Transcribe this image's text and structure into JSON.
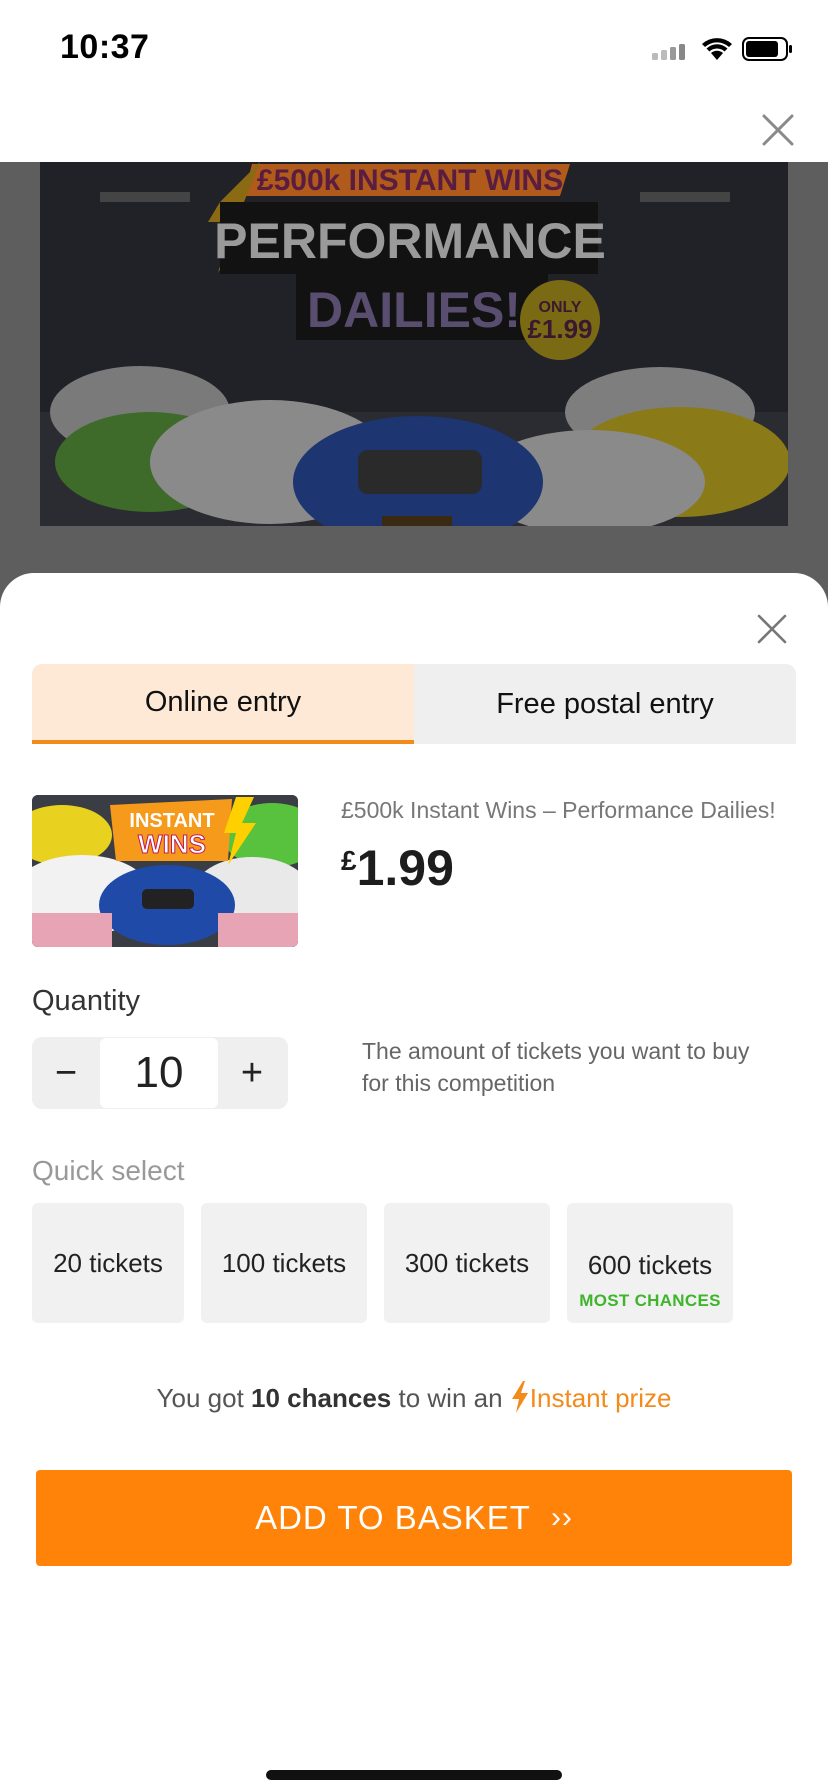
{
  "status_bar": {
    "time": "10:37"
  },
  "modal": {
    "tabs": [
      {
        "label": "Online entry",
        "active": true
      },
      {
        "label": "Free postal entry",
        "active": false
      }
    ],
    "product": {
      "title": "£500k Instant Wins – Performance Dailies!",
      "currency": "£",
      "price": "1.99",
      "thumb_text": {
        "line1": "INSTANT",
        "line2": "WINS"
      }
    },
    "quantity": {
      "label": "Quantity",
      "minus": "−",
      "value": "10",
      "plus": "+",
      "help": "The amount of tickets you want to buy for this competition"
    },
    "quick_select": {
      "label": "Quick select",
      "options": [
        {
          "label": "20 tickets",
          "badge": ""
        },
        {
          "label": "100 tickets",
          "badge": ""
        },
        {
          "label": "300 tickets",
          "badge": ""
        },
        {
          "label": "600 tickets",
          "badge": "MOST CHANCES"
        }
      ]
    },
    "chances": {
      "prefix": "You got",
      "count": "10 chances",
      "middle": "to win an",
      "prize": "Instant prize"
    },
    "cta": {
      "label": "ADD TO BASKET",
      "chevron": "››"
    }
  },
  "hero": {
    "banner_top": "£500k INSTANT WINS",
    "title_line1": "PERFORMANCE",
    "title_line2": "DAILIES!",
    "badge_line1": "ONLY",
    "badge_line2": "£1.99"
  },
  "colors": {
    "accent": "#ff8209",
    "tab_active_bg": "#fde9d6",
    "badge_green": "#3fb52c",
    "backdrop": "#5e5e5e"
  }
}
